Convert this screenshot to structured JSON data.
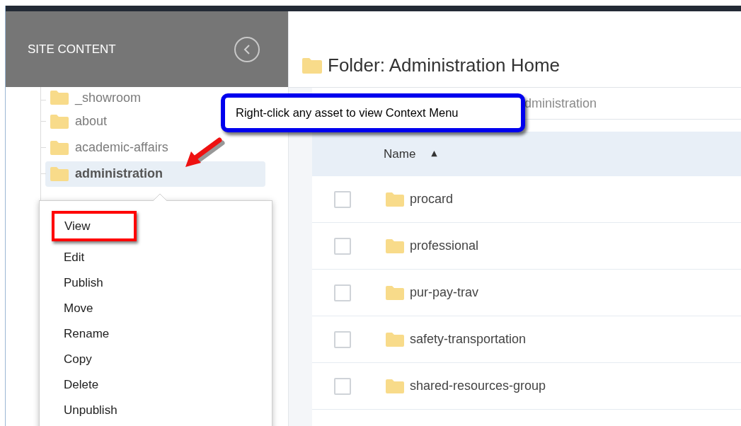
{
  "sidebar": {
    "title": "SITE CONTENT",
    "tree": [
      {
        "label": "_showroom",
        "selected": false
      },
      {
        "label": "about",
        "selected": false
      },
      {
        "label": "academic-affairs",
        "selected": false
      },
      {
        "label": "administration",
        "selected": true
      }
    ]
  },
  "main": {
    "title": "Folder: Administration Home",
    "breadcrumb": "dministration",
    "table": {
      "columns": [
        {
          "label": "Name",
          "sort_icon": "▲"
        }
      ],
      "rows": [
        {
          "name": "procard",
          "checked": false
        },
        {
          "name": "professional",
          "checked": false
        },
        {
          "name": "pur-pay-trav",
          "checked": false
        },
        {
          "name": "safety-transportation",
          "checked": false
        },
        {
          "name": "shared-resources-group",
          "checked": false
        }
      ]
    }
  },
  "context_menu": {
    "items": [
      {
        "label": "View",
        "annotated": true
      },
      {
        "label": "Edit",
        "annotated": false
      },
      {
        "label": "Publish",
        "annotated": false
      },
      {
        "label": "Move",
        "annotated": false
      },
      {
        "label": "Rename",
        "annotated": false
      },
      {
        "label": "Copy",
        "annotated": false
      },
      {
        "label": "Delete",
        "annotated": false
      },
      {
        "label": "Unpublish",
        "annotated": false
      }
    ]
  },
  "callout": {
    "text": "Right-click any asset to view Context Menu"
  }
}
